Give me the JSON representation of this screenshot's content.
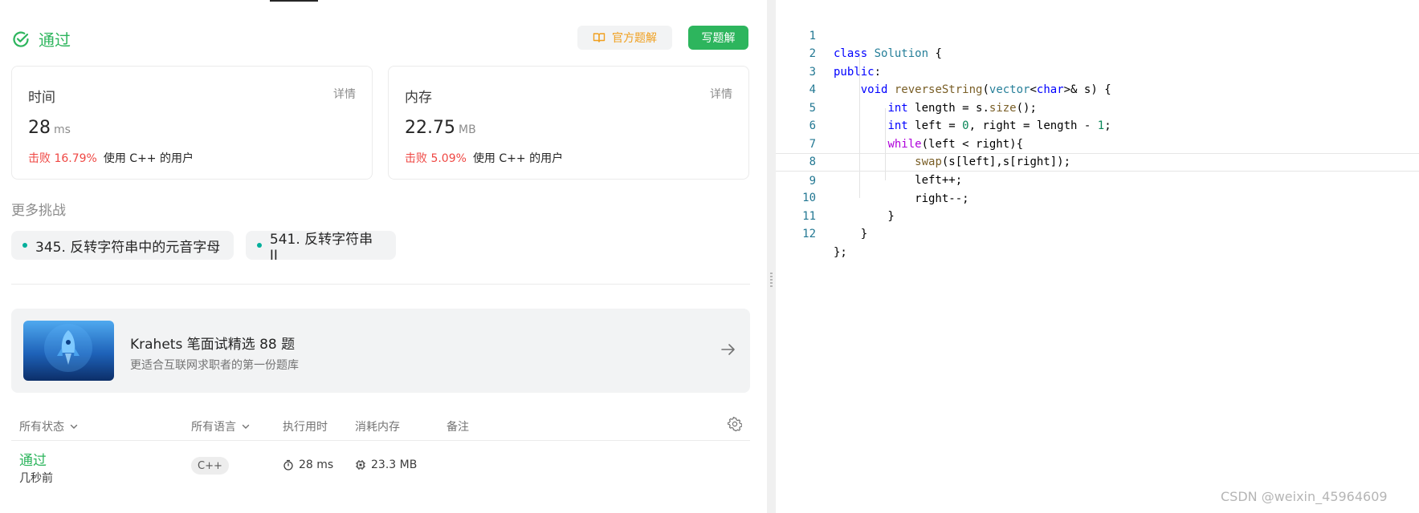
{
  "result": {
    "status_label": "通过",
    "official_solution_label": "官方题解",
    "write_solution_label": "写题解"
  },
  "stats": {
    "time": {
      "label": "时间",
      "detail": "详情",
      "value": "28",
      "unit": "ms",
      "beat_pct": "击败 16.79%",
      "beat_text": "使用 C++ 的用户"
    },
    "memory": {
      "label": "内存",
      "detail": "详情",
      "value": "22.75",
      "unit": "MB",
      "beat_pct": "击败 5.09%",
      "beat_text": "使用 C++ 的用户"
    }
  },
  "more_challenges": {
    "title": "更多挑战",
    "items": [
      {
        "label": "345. 反转字符串中的元音字母"
      },
      {
        "label": "541. 反转字符串 II"
      }
    ]
  },
  "promo": {
    "title": "Krahets 笔面试精选 88 题",
    "subtitle": "更适合互联网求职者的第一份题库"
  },
  "submissions": {
    "headers": {
      "status": "所有状态",
      "language": "所有语言",
      "runtime": "执行用时",
      "memory": "消耗内存",
      "note": "备注"
    },
    "rows": [
      {
        "status": "通过",
        "when": "几秒前",
        "language": "C++",
        "runtime": "28 ms",
        "memory": "23.3 MB"
      }
    ]
  },
  "editor": {
    "line_numbers": [
      "1",
      "2",
      "3",
      "4",
      "5",
      "6",
      "7",
      "8",
      "9",
      "10",
      "11",
      "12"
    ],
    "active_line": 9,
    "lines": [
      "class Solution {",
      "public:",
      "    void reverseString(vector<char>& s) {",
      "        int length = s.size();",
      "        int left = 0, right = length - 1;",
      "        while(left < right){",
      "            swap(s[left],s[right]);",
      "            left++;",
      "            right--;",
      "        }",
      "    }",
      "};"
    ]
  },
  "watermark": "CSDN @weixin_45964609",
  "colors": {
    "success": "#2db55d",
    "fail_pct": "#ef4743",
    "official": "#f0a020",
    "dot": "#00af9b"
  }
}
